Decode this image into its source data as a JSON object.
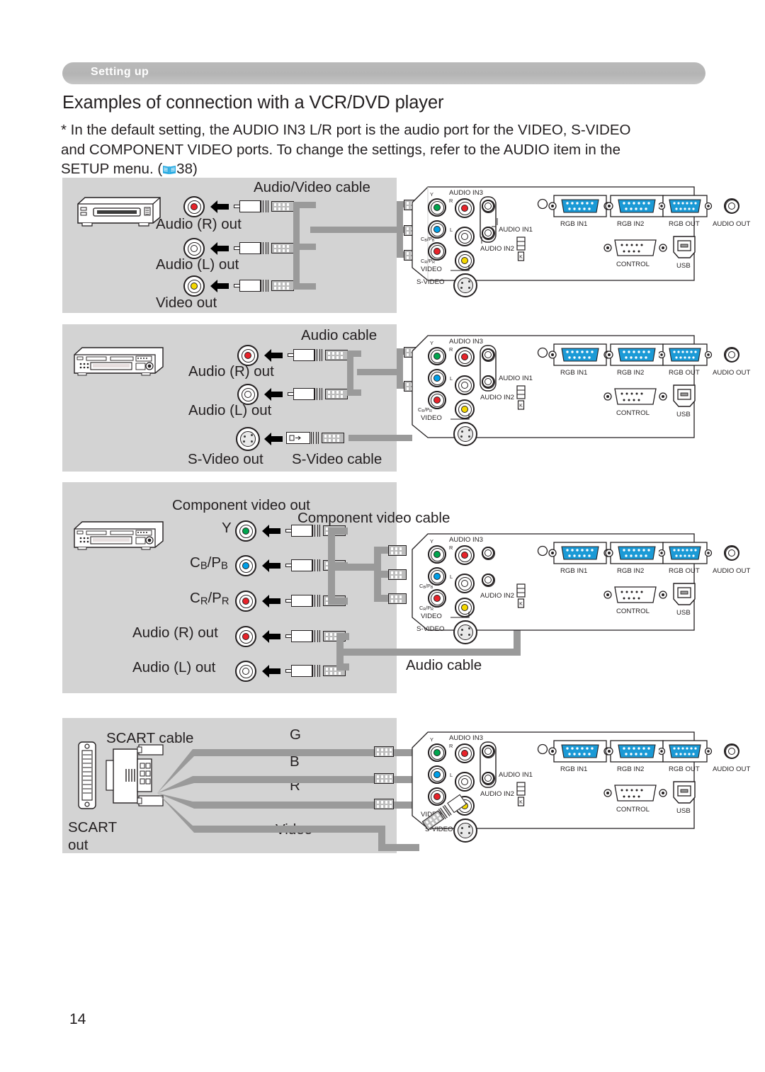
{
  "document": {
    "chapter_label": "Setting up",
    "page_number": "14",
    "title": "Examples of connection with a VCR/DVD player",
    "note_line1": "* In the default setting, the AUDIO IN3 L/R port is the audio port for the VIDEO, S-VIDEO",
    "note_line2": "and COMPONENT VIDEO ports. To change the settings, refer to the AUDIO item in the",
    "note_line3_pre": "SETUP menu. (",
    "note_reference_page": "38",
    "note_line3_post": ")",
    "book_icon_color": "#29abe2"
  },
  "panels": [
    {
      "id": "panel-avcable",
      "device": "vcr",
      "cable_label": "Audio/Video cable",
      "outputs": [
        {
          "label": "Audio (R) out",
          "jack_color": "#e8232a",
          "jack_name": "rca-jack-red"
        },
        {
          "label": "Audio (L) out",
          "jack_color": "#ffffff",
          "jack_name": "rca-jack-white"
        },
        {
          "label": "Video out",
          "jack_color": "#f5d800",
          "jack_name": "rca-jack-yellow"
        }
      ]
    },
    {
      "id": "panel-svideo",
      "device": "dvd",
      "cable_label": "Audio cable",
      "cable_label2": "S-Video cable",
      "outputs": [
        {
          "label": "Audio (R) out",
          "jack_color": "#e8232a",
          "jack_name": "rca-jack-red"
        },
        {
          "label": "Audio (L) out",
          "jack_color": "#ffffff",
          "jack_name": "rca-jack-white"
        },
        {
          "label": "S-Video out",
          "jack_color": "#e9e9e9",
          "jack_name": "s-video-jack"
        }
      ]
    },
    {
      "id": "panel-component",
      "device": "dvd",
      "group_label": "Component video out",
      "cable_label": "Component video cable",
      "cable_label2": "Audio cable",
      "outputs": [
        {
          "label": "Y",
          "jack_color": "#00a64f",
          "jack_name": "rca-jack-green"
        },
        {
          "label": "CB/PB",
          "jack_color": "#00a0e9",
          "jack_name": "rca-jack-blue"
        },
        {
          "label": "CR/PR",
          "jack_color": "#e8232a",
          "jack_name": "rca-jack-red"
        },
        {
          "label": "Audio (R) out",
          "jack_color": "#e8232a",
          "jack_name": "rca-jack-red"
        },
        {
          "label": "Audio (L) out",
          "jack_color": "#ffffff",
          "jack_name": "rca-jack-white"
        }
      ]
    },
    {
      "id": "panel-scart",
      "device": "scart",
      "cable_label": "SCART cable",
      "source_label_line1": "SCART",
      "source_label_line2": "out",
      "leads": [
        "G",
        "B",
        "R",
        "Video"
      ]
    }
  ],
  "projector_ports": {
    "audio_in3": "AUDIO IN3",
    "audio_in3_r": "R",
    "audio_in3_l": "L",
    "audio_in1": "AUDIO IN1",
    "audio_in2": "AUDIO IN2",
    "video": "VIDEO",
    "s_video": "S-VIDEO",
    "y": "Y",
    "cb_pb": "CB/PB",
    "cr_pr": "CR/PR",
    "rgb_in1": "RGB IN1",
    "rgb_in2": "RGB IN2",
    "rgb_out": "RGB OUT",
    "audio_out": "AUDIO OUT",
    "control": "CONTROL",
    "usb": "USB",
    "vga_color": "#1b9ad6"
  }
}
